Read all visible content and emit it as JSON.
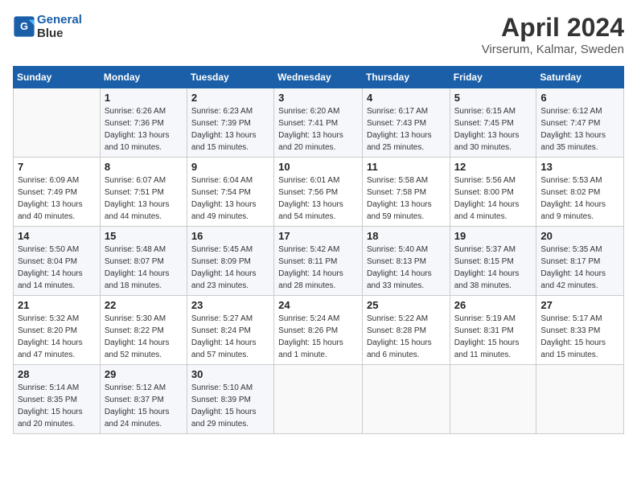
{
  "header": {
    "logo_line1": "General",
    "logo_line2": "Blue",
    "month": "April 2024",
    "location": "Virserum, Kalmar, Sweden"
  },
  "weekdays": [
    "Sunday",
    "Monday",
    "Tuesday",
    "Wednesday",
    "Thursday",
    "Friday",
    "Saturday"
  ],
  "weeks": [
    [
      {
        "day": "",
        "sunrise": "",
        "sunset": "",
        "daylight": ""
      },
      {
        "day": "1",
        "sunrise": "Sunrise: 6:26 AM",
        "sunset": "Sunset: 7:36 PM",
        "daylight": "Daylight: 13 hours and 10 minutes."
      },
      {
        "day": "2",
        "sunrise": "Sunrise: 6:23 AM",
        "sunset": "Sunset: 7:39 PM",
        "daylight": "Daylight: 13 hours and 15 minutes."
      },
      {
        "day": "3",
        "sunrise": "Sunrise: 6:20 AM",
        "sunset": "Sunset: 7:41 PM",
        "daylight": "Daylight: 13 hours and 20 minutes."
      },
      {
        "day": "4",
        "sunrise": "Sunrise: 6:17 AM",
        "sunset": "Sunset: 7:43 PM",
        "daylight": "Daylight: 13 hours and 25 minutes."
      },
      {
        "day": "5",
        "sunrise": "Sunrise: 6:15 AM",
        "sunset": "Sunset: 7:45 PM",
        "daylight": "Daylight: 13 hours and 30 minutes."
      },
      {
        "day": "6",
        "sunrise": "Sunrise: 6:12 AM",
        "sunset": "Sunset: 7:47 PM",
        "daylight": "Daylight: 13 hours and 35 minutes."
      }
    ],
    [
      {
        "day": "7",
        "sunrise": "Sunrise: 6:09 AM",
        "sunset": "Sunset: 7:49 PM",
        "daylight": "Daylight: 13 hours and 40 minutes."
      },
      {
        "day": "8",
        "sunrise": "Sunrise: 6:07 AM",
        "sunset": "Sunset: 7:51 PM",
        "daylight": "Daylight: 13 hours and 44 minutes."
      },
      {
        "day": "9",
        "sunrise": "Sunrise: 6:04 AM",
        "sunset": "Sunset: 7:54 PM",
        "daylight": "Daylight: 13 hours and 49 minutes."
      },
      {
        "day": "10",
        "sunrise": "Sunrise: 6:01 AM",
        "sunset": "Sunset: 7:56 PM",
        "daylight": "Daylight: 13 hours and 54 minutes."
      },
      {
        "day": "11",
        "sunrise": "Sunrise: 5:58 AM",
        "sunset": "Sunset: 7:58 PM",
        "daylight": "Daylight: 13 hours and 59 minutes."
      },
      {
        "day": "12",
        "sunrise": "Sunrise: 5:56 AM",
        "sunset": "Sunset: 8:00 PM",
        "daylight": "Daylight: 14 hours and 4 minutes."
      },
      {
        "day": "13",
        "sunrise": "Sunrise: 5:53 AM",
        "sunset": "Sunset: 8:02 PM",
        "daylight": "Daylight: 14 hours and 9 minutes."
      }
    ],
    [
      {
        "day": "14",
        "sunrise": "Sunrise: 5:50 AM",
        "sunset": "Sunset: 8:04 PM",
        "daylight": "Daylight: 14 hours and 14 minutes."
      },
      {
        "day": "15",
        "sunrise": "Sunrise: 5:48 AM",
        "sunset": "Sunset: 8:07 PM",
        "daylight": "Daylight: 14 hours and 18 minutes."
      },
      {
        "day": "16",
        "sunrise": "Sunrise: 5:45 AM",
        "sunset": "Sunset: 8:09 PM",
        "daylight": "Daylight: 14 hours and 23 minutes."
      },
      {
        "day": "17",
        "sunrise": "Sunrise: 5:42 AM",
        "sunset": "Sunset: 8:11 PM",
        "daylight": "Daylight: 14 hours and 28 minutes."
      },
      {
        "day": "18",
        "sunrise": "Sunrise: 5:40 AM",
        "sunset": "Sunset: 8:13 PM",
        "daylight": "Daylight: 14 hours and 33 minutes."
      },
      {
        "day": "19",
        "sunrise": "Sunrise: 5:37 AM",
        "sunset": "Sunset: 8:15 PM",
        "daylight": "Daylight: 14 hours and 38 minutes."
      },
      {
        "day": "20",
        "sunrise": "Sunrise: 5:35 AM",
        "sunset": "Sunset: 8:17 PM",
        "daylight": "Daylight: 14 hours and 42 minutes."
      }
    ],
    [
      {
        "day": "21",
        "sunrise": "Sunrise: 5:32 AM",
        "sunset": "Sunset: 8:20 PM",
        "daylight": "Daylight: 14 hours and 47 minutes."
      },
      {
        "day": "22",
        "sunrise": "Sunrise: 5:30 AM",
        "sunset": "Sunset: 8:22 PM",
        "daylight": "Daylight: 14 hours and 52 minutes."
      },
      {
        "day": "23",
        "sunrise": "Sunrise: 5:27 AM",
        "sunset": "Sunset: 8:24 PM",
        "daylight": "Daylight: 14 hours and 57 minutes."
      },
      {
        "day": "24",
        "sunrise": "Sunrise: 5:24 AM",
        "sunset": "Sunset: 8:26 PM",
        "daylight": "Daylight: 15 hours and 1 minute."
      },
      {
        "day": "25",
        "sunrise": "Sunrise: 5:22 AM",
        "sunset": "Sunset: 8:28 PM",
        "daylight": "Daylight: 15 hours and 6 minutes."
      },
      {
        "day": "26",
        "sunrise": "Sunrise: 5:19 AM",
        "sunset": "Sunset: 8:31 PM",
        "daylight": "Daylight: 15 hours and 11 minutes."
      },
      {
        "day": "27",
        "sunrise": "Sunrise: 5:17 AM",
        "sunset": "Sunset: 8:33 PM",
        "daylight": "Daylight: 15 hours and 15 minutes."
      }
    ],
    [
      {
        "day": "28",
        "sunrise": "Sunrise: 5:14 AM",
        "sunset": "Sunset: 8:35 PM",
        "daylight": "Daylight: 15 hours and 20 minutes."
      },
      {
        "day": "29",
        "sunrise": "Sunrise: 5:12 AM",
        "sunset": "Sunset: 8:37 PM",
        "daylight": "Daylight: 15 hours and 24 minutes."
      },
      {
        "day": "30",
        "sunrise": "Sunrise: 5:10 AM",
        "sunset": "Sunset: 8:39 PM",
        "daylight": "Daylight: 15 hours and 29 minutes."
      },
      {
        "day": "",
        "sunrise": "",
        "sunset": "",
        "daylight": ""
      },
      {
        "day": "",
        "sunrise": "",
        "sunset": "",
        "daylight": ""
      },
      {
        "day": "",
        "sunrise": "",
        "sunset": "",
        "daylight": ""
      },
      {
        "day": "",
        "sunrise": "",
        "sunset": "",
        "daylight": ""
      }
    ]
  ]
}
